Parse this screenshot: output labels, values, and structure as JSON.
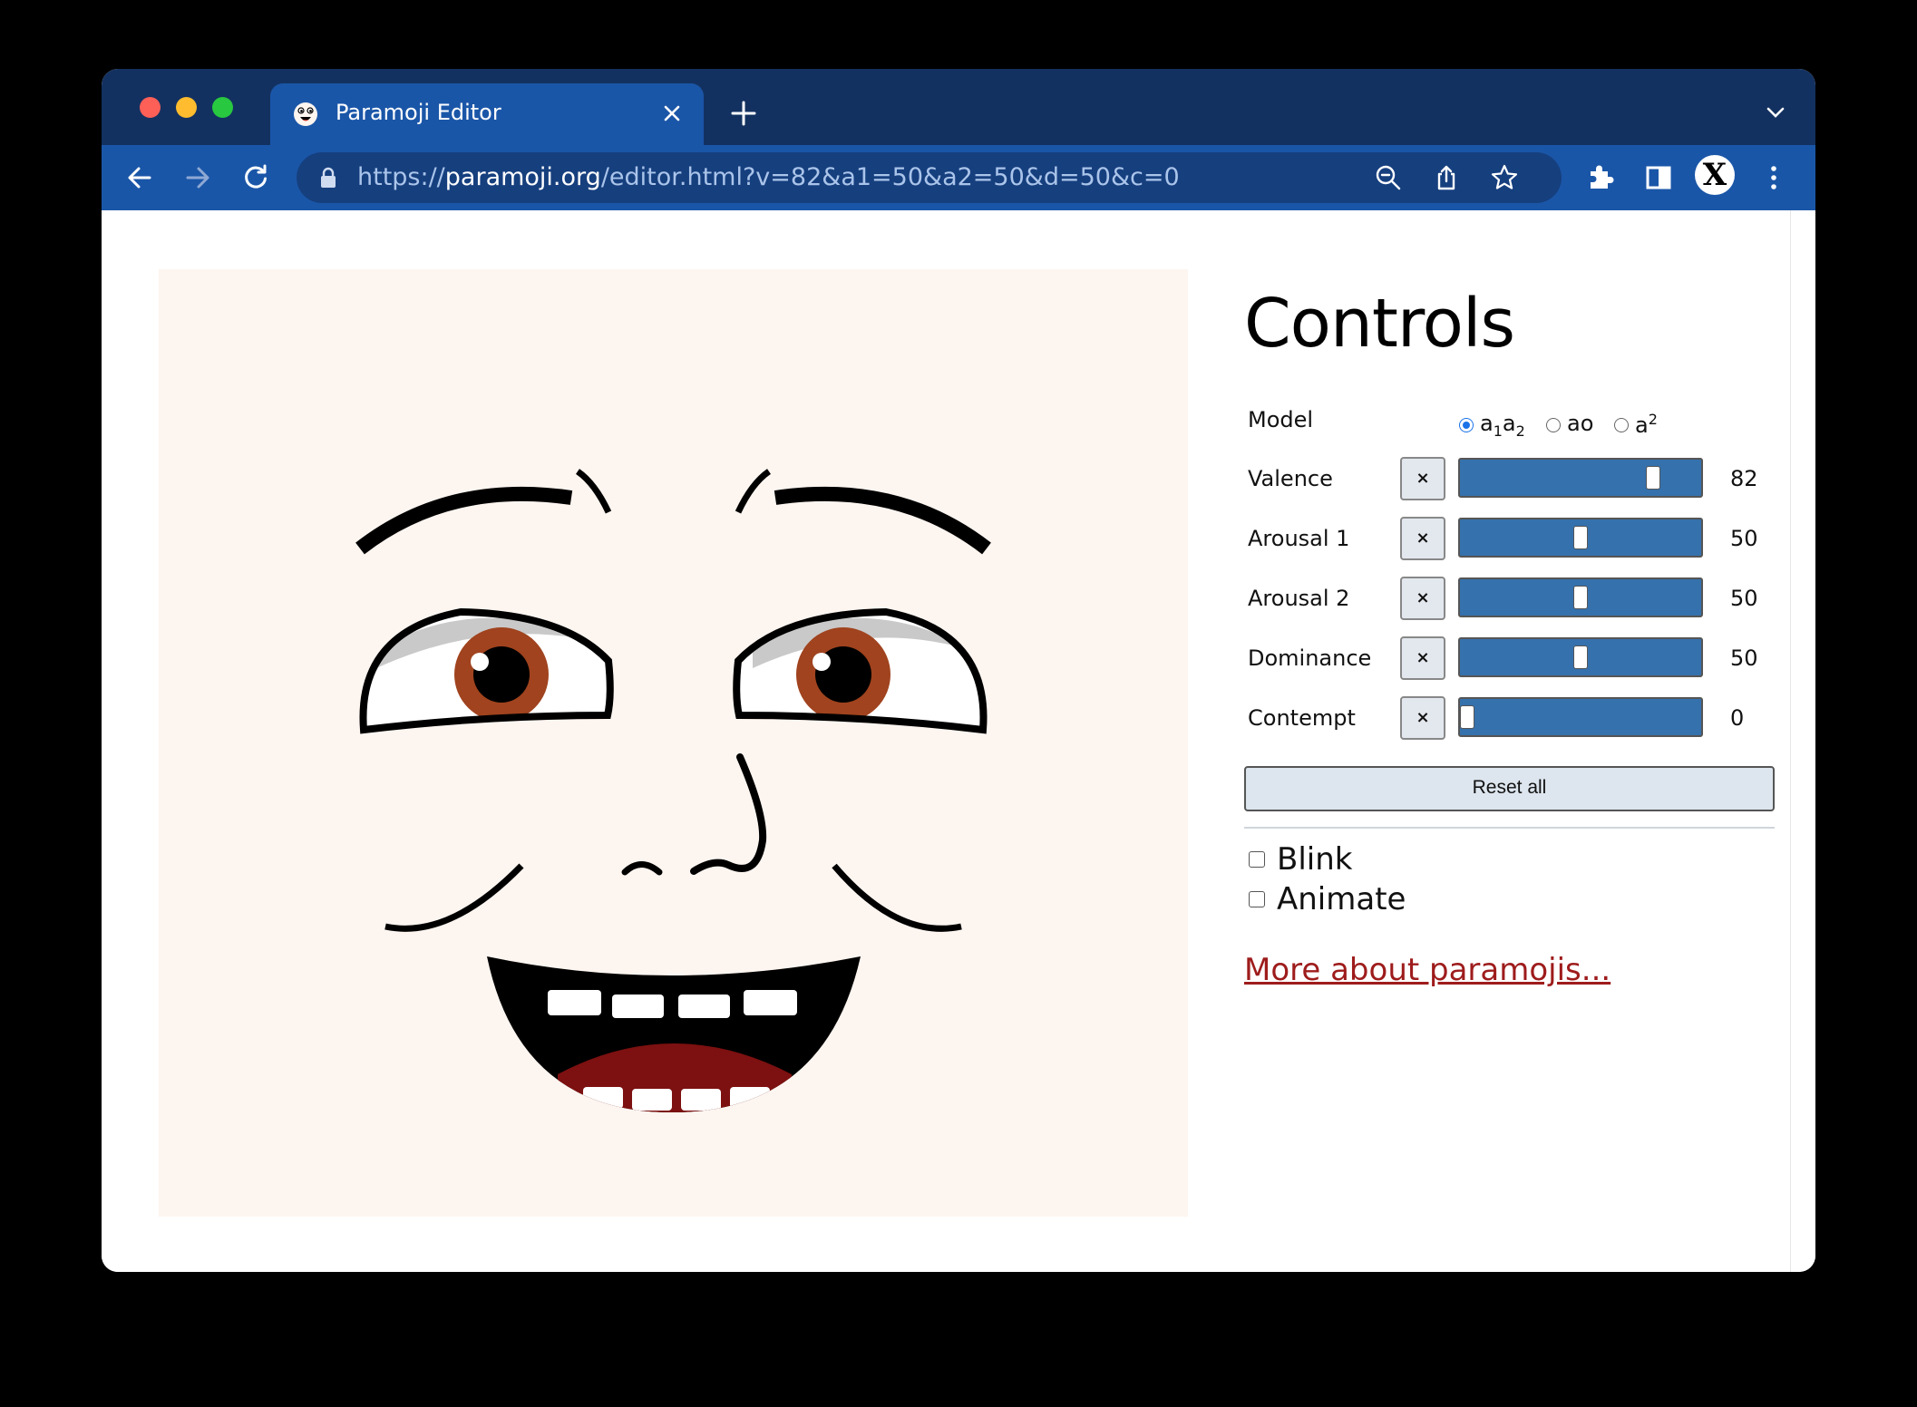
{
  "browser": {
    "tab_title": "Paramoji Editor",
    "url_scheme": "https://",
    "url_host": "paramoji.org",
    "url_path": "/editor.html?v=82&a1=50&a2=50&d=50&c=0",
    "profile_initial": "X"
  },
  "controls": {
    "title": "Controls",
    "model": {
      "label": "Model",
      "options": [
        {
          "base": "a",
          "sub1": "1",
          "mid": "a",
          "sub2": "2",
          "checked": true
        },
        {
          "text": "ao",
          "checked": false
        },
        {
          "base": "a",
          "sup": "2",
          "checked": false
        }
      ]
    },
    "sliders": [
      {
        "label": "Valence",
        "value": 82,
        "clear": "×"
      },
      {
        "label": "Arousal 1",
        "value": 50,
        "clear": "×"
      },
      {
        "label": "Arousal 2",
        "value": 50,
        "clear": "×"
      },
      {
        "label": "Dominance",
        "value": 50,
        "clear": "×"
      },
      {
        "label": "Contempt",
        "value": 0,
        "clear": "×"
      }
    ],
    "reset_label": "Reset all",
    "checkboxes": [
      {
        "label": "Blink",
        "checked": false
      },
      {
        "label": "Animate",
        "checked": false
      }
    ],
    "more_link": "More about paramojis..."
  },
  "colors": {
    "chrome_dark": "#133160",
    "chrome_blue": "#1a56a8",
    "face_bg": "#fdf5f0",
    "iris": "#a0431e",
    "mouth_tongue": "#7d1010",
    "slider_fill": "#3571ad",
    "link": "#9e1c1c"
  }
}
